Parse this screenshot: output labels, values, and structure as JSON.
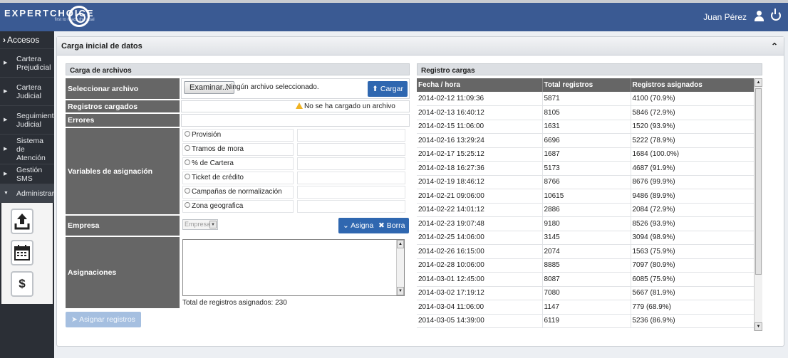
{
  "header": {
    "brand": "EXPERTCHOICE",
    "tagline": "first to reach the goal",
    "user_name": "Juan Pérez"
  },
  "sidebar": {
    "title": "Accesos",
    "items": [
      {
        "label": "Cartera\nPrejudicial"
      },
      {
        "label": "Cartera\nJudicial"
      },
      {
        "label": "Seguimiento\nJudicial"
      },
      {
        "label": "Sistema de\nAtención"
      },
      {
        "label": "Gestión SMS"
      },
      {
        "label": "Administrar"
      }
    ],
    "sub_icons": [
      "upload-icon",
      "calendar-icon",
      "dollar-icon"
    ],
    "dollar_symbol": "$"
  },
  "main": {
    "title": "Carga inicial de datos"
  },
  "form": {
    "section_title": "Carga de archivos",
    "select_file_label": "Seleccionar archivo",
    "browse_button": "Examinar...",
    "file_status": "Ningún archivo seleccionado.",
    "upload_button": "Cargar",
    "loaded_records_label": "Registros cargados",
    "no_file_warning": "No se ha cargado un archivo",
    "errors_label": "Errores",
    "assign_vars_label": "Variables de asignación",
    "options": [
      "Provisión",
      "Tramos de mora",
      "% de Cartera",
      "Ticket de crédito",
      "Campañas de normalización",
      "Zona geografica"
    ],
    "company_label": "Empresa",
    "company_value": "Empresa A",
    "assign_button": "Asigna",
    "clear_button": "Borra",
    "assignments_label": "Asignaciones",
    "total_assigned": "Total de registros asignados: 230",
    "assign_records_button": "Asignar registros"
  },
  "records": {
    "section_title": "Registro cargas",
    "columns": [
      "Fecha / hora",
      "Total registros",
      "Registros asignados"
    ],
    "rows": [
      [
        "2014-02-12 11:09:36",
        "5871",
        "4100 (70.9%)"
      ],
      [
        "2014-02-13 16:40:12",
        "8105",
        "5846 (72.9%)"
      ],
      [
        "2014-02-15 11:06:00",
        "1631",
        "1520 (93.9%)"
      ],
      [
        "2014-02-16 13:29:24",
        "6696",
        "5222 (78.9%)"
      ],
      [
        "2014-02-17 15:25:12",
        "1687",
        "1684 (100.0%)"
      ],
      [
        "2014-02-18 16:27:36",
        "5173",
        "4687 (91.9%)"
      ],
      [
        "2014-02-19 18:46:12",
        "8766",
        "8676 (99.9%)"
      ],
      [
        "2014-02-21 09:06:00",
        "10615",
        "9486 (89.9%)"
      ],
      [
        "2014-02-22 14:01:12",
        "2886",
        "2084 (72.9%)"
      ],
      [
        "2014-02-23 19:07:48",
        "9180",
        "8526 (93.9%)"
      ],
      [
        "2014-02-25 14:06:00",
        "3145",
        "3094 (98.9%)"
      ],
      [
        "2014-02-26 16:15:00",
        "2074",
        "1563 (75.9%)"
      ],
      [
        "2014-02-28 10:06:00",
        "8885",
        "7097 (80.9%)"
      ],
      [
        "2014-03-01 12:45:00",
        "8087",
        "6085 (75.9%)"
      ],
      [
        "2014-03-02 17:19:12",
        "7080",
        "5667 (81.9%)"
      ],
      [
        "2014-03-04 11:06:00",
        "1147",
        "779 (68.9%)"
      ],
      [
        "2014-03-05 14:39:00",
        "6119",
        "5236 (86.9%)"
      ]
    ]
  },
  "colors": {
    "header_bg": "#3a5a93",
    "sidebar_bg": "#2b2f36",
    "label_bg": "#666666",
    "primary_button": "#2f67b0",
    "warning": "#f0b323"
  }
}
